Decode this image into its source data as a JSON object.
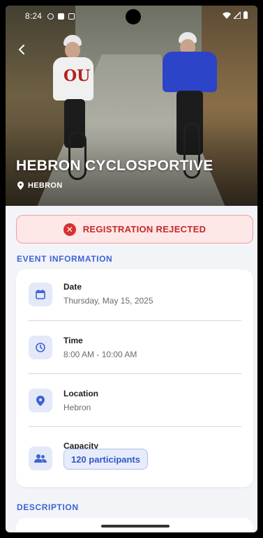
{
  "status_bar": {
    "time": "8:24"
  },
  "event": {
    "title": "HEBRON CYCLOSPORTIVE",
    "location": "HEBRON"
  },
  "status_banner": {
    "text": "REGISTRATION REJECTED"
  },
  "sections": {
    "info_heading": "EVENT INFORMATION",
    "description_heading": "DESCRIPTION"
  },
  "info": [
    {
      "label": "Date",
      "value": "Thursday, May 15, 2025",
      "icon": "calendar-icon"
    },
    {
      "label": "Time",
      "value": "8:00 AM - 10:00 AM",
      "icon": "clock-icon"
    },
    {
      "label": "Location",
      "value": "Hebron",
      "icon": "location-pin-icon"
    },
    {
      "label": "Capacity",
      "value": "120 participants",
      "icon": "people-icon"
    }
  ],
  "colors": {
    "accent": "#3d63d6",
    "rejected": "#c62828",
    "rejected_bg": "#fde7e7"
  }
}
